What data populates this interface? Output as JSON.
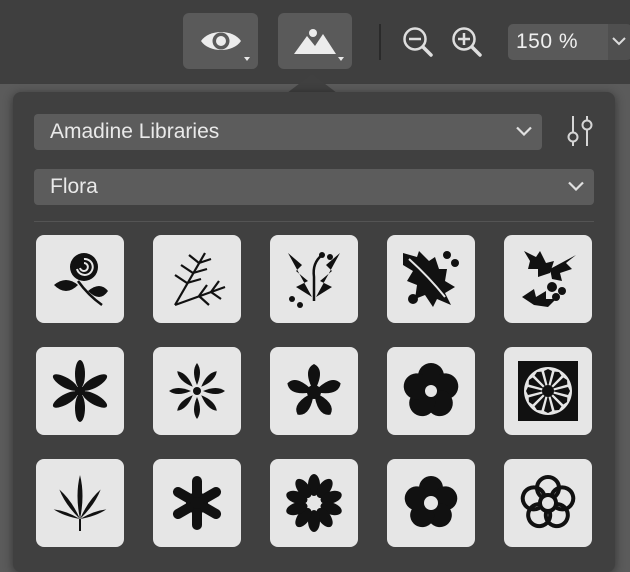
{
  "toolbar": {
    "view_button_icon": "eye-icon",
    "image_button_icon": "mountains-image-icon",
    "zoom_out_icon": "zoom-out-icon",
    "zoom_in_icon": "zoom-in-icon",
    "zoom_value": "150 %"
  },
  "library_popover": {
    "library_select": "Amadine Libraries",
    "category_select": "Flora",
    "filters_icon": "sliders-icon",
    "symbols": [
      {
        "name": "rose"
      },
      {
        "name": "pine-branches"
      },
      {
        "name": "mistletoe"
      },
      {
        "name": "holly-leaf"
      },
      {
        "name": "holly-sprig"
      },
      {
        "name": "six-petal-flower"
      },
      {
        "name": "starburst-flower"
      },
      {
        "name": "five-petal-flower"
      },
      {
        "name": "round-five-petal-flower"
      },
      {
        "name": "ornate-tile-flower"
      },
      {
        "name": "cannabis-leaf"
      },
      {
        "name": "eight-petal-flower"
      },
      {
        "name": "daisy"
      },
      {
        "name": "round-petal-flower"
      },
      {
        "name": "outlined-flower"
      }
    ]
  },
  "colors": {
    "toolbar_bg": "#3f3f3f",
    "popover_bg": "#404040",
    "tile_bg": "#e6e6e6",
    "symbol_fill": "#111111"
  }
}
